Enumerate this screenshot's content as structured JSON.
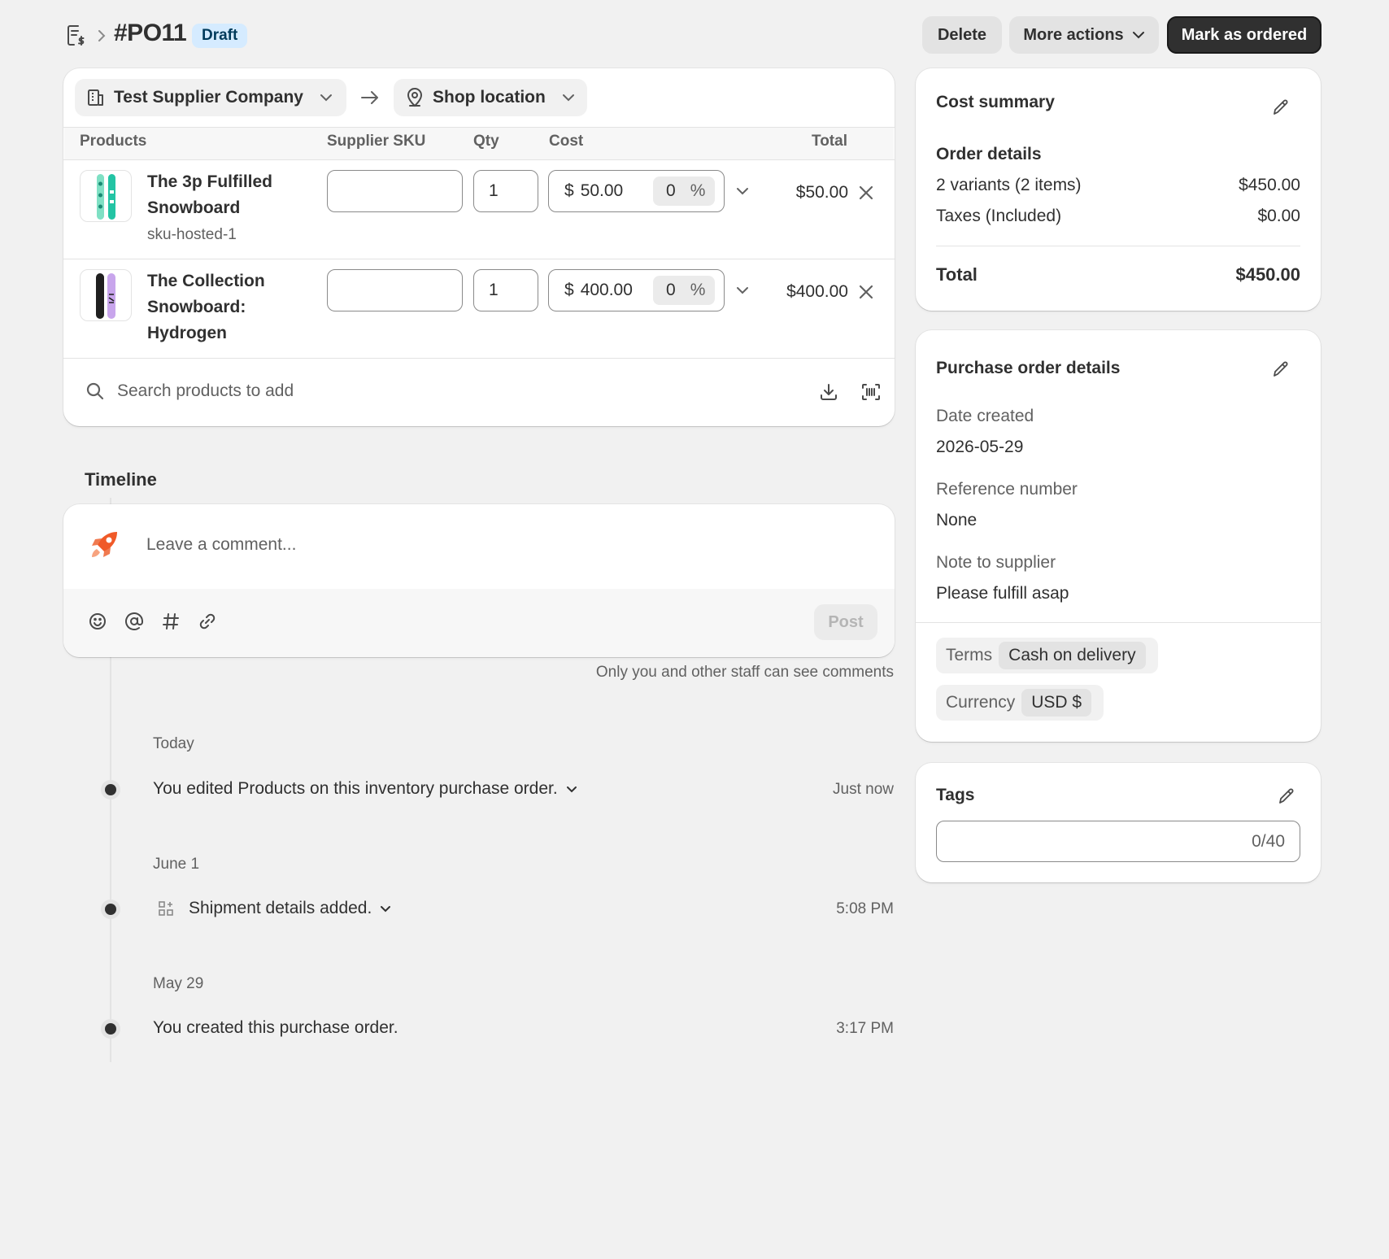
{
  "header": {
    "title": "#PO11",
    "status_badge": "Draft",
    "delete_label": "Delete",
    "more_actions_label": "More actions",
    "mark_ordered_label": "Mark as ordered"
  },
  "supplier": {
    "name": "Test Supplier Company"
  },
  "destination": {
    "name": "Shop location"
  },
  "table": {
    "headers": [
      "Products",
      "Supplier SKU",
      "Qty",
      "Cost",
      "Total"
    ],
    "rows": [
      {
        "name_line1": "The 3p Fulfilled",
        "name_line2": "Snowboard",
        "sku": "sku-hosted-1",
        "supplier_sku": "",
        "qty": "1",
        "currency_symbol": "$",
        "cost": "50.00",
        "tax_percent": "0",
        "percent_sign": "%",
        "total": "$50.00"
      },
      {
        "name_line1": "The Collection",
        "name_line2": "Snowboard:",
        "name_line3": "Hydrogen",
        "supplier_sku": "",
        "qty": "1",
        "currency_symbol": "$",
        "cost": "400.00",
        "tax_percent": "0",
        "percent_sign": "%",
        "total": "$400.00"
      }
    ],
    "search_placeholder": "Search products to add"
  },
  "timeline": {
    "title": "Timeline",
    "comment_placeholder": "Leave a comment...",
    "post_label": "Post",
    "staff_note": "Only you and other staff can see comments",
    "groups": [
      {
        "date": "Today",
        "event": "You edited Products on this inventory purchase order.",
        "time": "Just now"
      },
      {
        "date": "June 1",
        "event": "Shipment details added.",
        "time": "5:08 PM"
      },
      {
        "date": "May 29",
        "event": "You created this purchase order.",
        "time": "3:17 PM"
      }
    ]
  },
  "cost_summary": {
    "title": "Cost summary",
    "order_details_label": "Order details",
    "variants_label": "2 variants (2 items)",
    "variants_value": "$450.00",
    "taxes_label": "Taxes (Included)",
    "taxes_value": "$0.00",
    "total_label": "Total",
    "total_value": "$450.00"
  },
  "po_details": {
    "title": "Purchase order details",
    "date_created_label": "Date created",
    "date_created_value": "2026-05-29",
    "reference_label": "Reference number",
    "reference_value": "None",
    "note_label": "Note to supplier",
    "note_value": "Please fulfill asap",
    "terms_label": "Terms",
    "terms_value": "Cash on delivery",
    "currency_label": "Currency",
    "currency_value": "USD $"
  },
  "tags": {
    "title": "Tags",
    "counter": "0/40"
  },
  "colors": {
    "accent_dark": "#303030",
    "draft_badge_bg": "#d5ebff",
    "draft_badge_text": "#003a5a",
    "page_bg": "#f1f1f1",
    "avatar_orange": "#f05a28"
  }
}
